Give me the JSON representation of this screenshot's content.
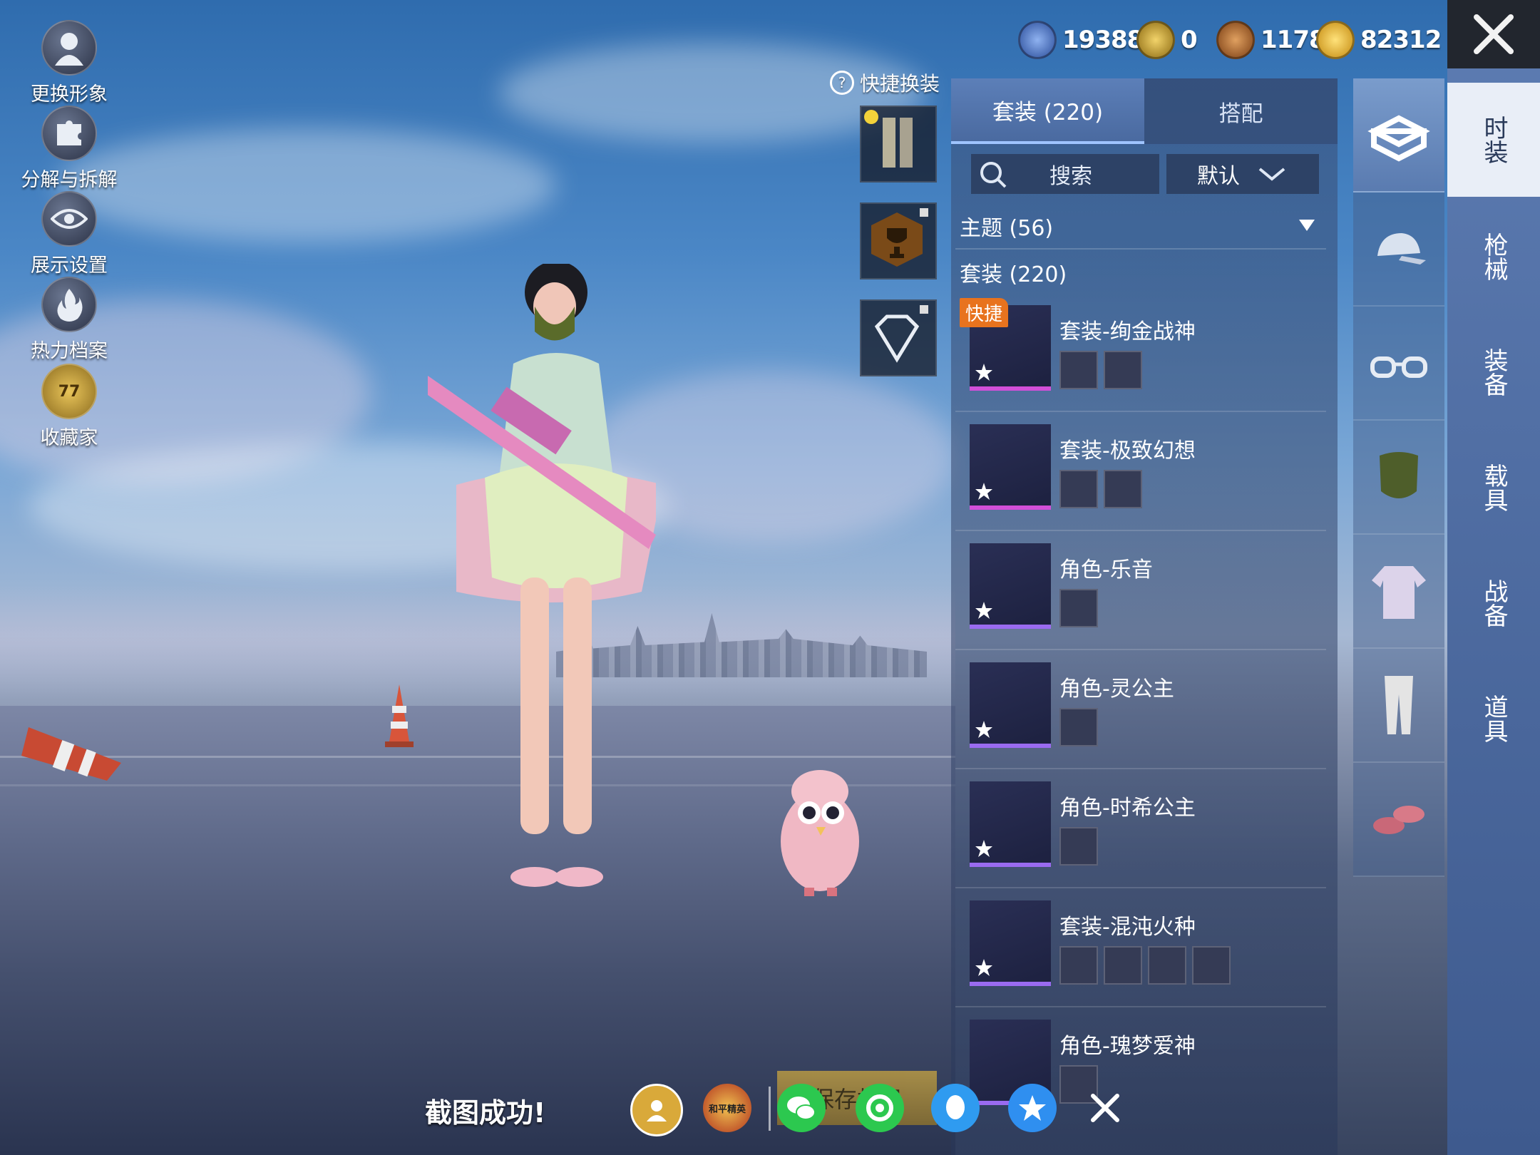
{
  "left_menu": [
    {
      "label": "更换形象",
      "icon": "avatar-icon"
    },
    {
      "label": "分解与拆解",
      "icon": "puzzle-icon"
    },
    {
      "label": "展示设置",
      "icon": "eye-icon"
    },
    {
      "label": "热力档案",
      "icon": "flame-icon"
    },
    {
      "label": "收藏家",
      "icon": "collector-badge-icon",
      "badge": "77"
    }
  ],
  "currencies": [
    {
      "value": "19388",
      "icon": "medal-coin-icon",
      "color": "#3a63b8"
    },
    {
      "value": "0",
      "icon": "gold-emblem-icon",
      "color": "#c9a227"
    },
    {
      "value": "1178",
      "icon": "bronze-token-icon",
      "color": "#b06a2e"
    },
    {
      "value": "82312",
      "icon": "lightning-coin-icon",
      "color": "#e0b232"
    }
  ],
  "quick_outfit": {
    "label": "快捷换装"
  },
  "tabs": [
    {
      "label": "套装 (220)",
      "active": true
    },
    {
      "label": "搭配",
      "active": false
    }
  ],
  "search": {
    "placeholder": "搜索"
  },
  "sort": {
    "label": "默认"
  },
  "sections": {
    "theme": "主题 (56)",
    "sets": "套装 (220)"
  },
  "quick_badge": "快捷",
  "items": [
    {
      "name": "套装-绚金战神",
      "parts": 2,
      "rarity": "rare"
    },
    {
      "name": "套装-极致幻想",
      "parts": 2,
      "rarity": "rare"
    },
    {
      "name": "角色-乐音",
      "parts": 1,
      "rarity": "epic"
    },
    {
      "name": "角色-灵公主",
      "parts": 1,
      "rarity": "epic"
    },
    {
      "name": "角色-时希公主",
      "parts": 1,
      "rarity": "epic"
    },
    {
      "name": "套装-混沌火种",
      "parts": 4,
      "rarity": "epic"
    },
    {
      "name": "角色-瑰梦爱神",
      "parts": 1,
      "rarity": "epic"
    }
  ],
  "categories": [
    {
      "icon": "outfit-box-icon"
    },
    {
      "icon": "cap-icon"
    },
    {
      "icon": "glasses-icon"
    },
    {
      "icon": "mask-icon"
    },
    {
      "icon": "clothes-icon"
    },
    {
      "icon": "pants-icon"
    },
    {
      "icon": "shoes-icon"
    }
  ],
  "side_tabs": [
    {
      "label": "时装",
      "selected": true
    },
    {
      "label": "枪械",
      "selected": false
    },
    {
      "label": "装备",
      "selected": false
    },
    {
      "label": "载具",
      "selected": false
    },
    {
      "label": "战备",
      "selected": false
    },
    {
      "label": "道具",
      "selected": false
    }
  ],
  "bottom": {
    "toast": "截图成功!",
    "save_button": "保存相册",
    "peace_elite_logo": "和平精英",
    "share_icons": [
      "gamecenter-share-icon",
      "peace-elite-share-icon",
      "wechat-icon",
      "moments-icon",
      "qq-icon",
      "qzone-icon",
      "close-icon"
    ]
  }
}
